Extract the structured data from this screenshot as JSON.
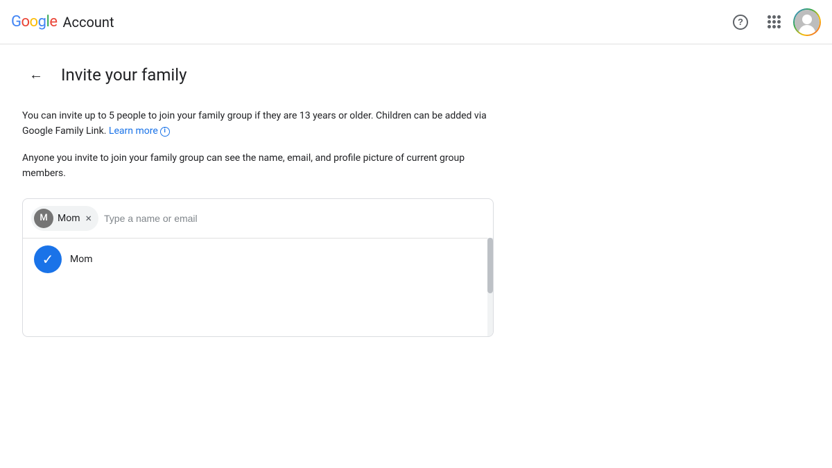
{
  "header": {
    "logo": {
      "letters": [
        "G",
        "o",
        "o",
        "g",
        "l",
        "e"
      ],
      "account_text": "Account"
    },
    "help_label": "?",
    "apps_label": "Google apps",
    "account_label": "Google Account"
  },
  "page": {
    "back_label": "←",
    "title": "Invite your family",
    "description1": "You can invite up to 5 people to join your family group if they are 13 years or older. Children can be added via Google Family Link.",
    "learn_more_text": "Learn more",
    "learn_more_icon": "i",
    "description2": "Anyone you invite to join your family group can see the name, email, and profile picture of current group members."
  },
  "invite_box": {
    "chip": {
      "avatar_letter": "M",
      "label": "Mom",
      "remove_label": "×"
    },
    "input_placeholder": "Type a name or email"
  },
  "dropdown": {
    "items": [
      {
        "name": "Mom",
        "selected": true
      }
    ]
  }
}
